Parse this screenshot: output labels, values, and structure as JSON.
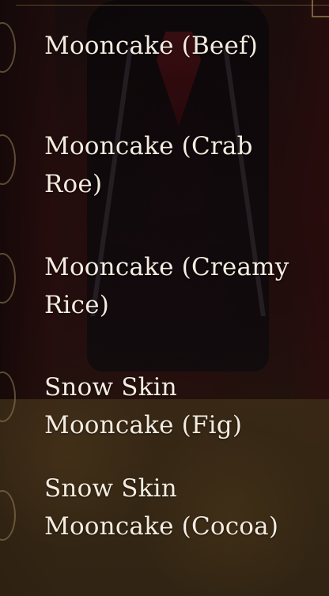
{
  "items": [
    {
      "label": "Mooncake (Beef)"
    },
    {
      "label": "Mooncake (Crab Roe)"
    },
    {
      "label": "Mooncake (Creamy Rice)"
    },
    {
      "label": "Snow Skin Mooncake (Fig)"
    },
    {
      "label": "Snow Skin Mooncake (Cocoa)"
    }
  ]
}
